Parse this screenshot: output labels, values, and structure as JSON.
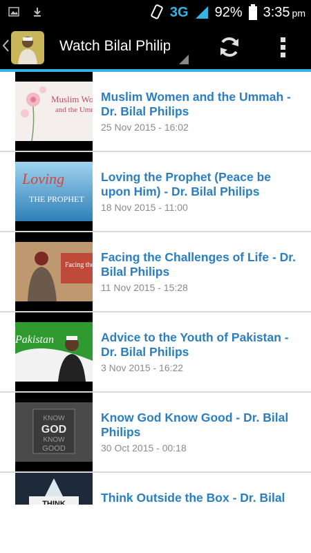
{
  "status_bar": {
    "network": "3G",
    "battery": "92%",
    "time": "3:35",
    "ampm": "pm"
  },
  "action_bar": {
    "title": "Watch Bilal Philips"
  },
  "videos": [
    {
      "title": "Muslim Women and the Ummah - Dr. Bilal Philips",
      "date": "25 Nov 2015 - 16:02",
      "thumb_text": "Muslim Women",
      "thumb_sub": "and the Ummah"
    },
    {
      "title": "Loving the Prophet (Peace be upon Him) - Dr. Bilal Philips",
      "date": "18 Nov 2015 - 11:00",
      "thumb_text": "Loving",
      "thumb_sub": "THE PROPHET"
    },
    {
      "title": "Facing the Challenges of Life - Dr. Bilal Philips",
      "date": "11 Nov 2015 - 15:28",
      "thumb_text": "Facing the Challenges of Life"
    },
    {
      "title": "Advice to the Youth of Pakistan - Dr. Bilal Philips",
      "date": "3 Nov 2015 - 16:22",
      "thumb_text": "Pakistan"
    },
    {
      "title": "Know God Know Good - Dr. Bilal Philips",
      "date": "30 Oct 2015 - 00:18",
      "thumb_text": "KNOW GOD KNOW GOOD"
    },
    {
      "title": "Think Outside the Box - Dr. Bilal Philips",
      "date": "",
      "thumb_text": "THINK"
    }
  ]
}
